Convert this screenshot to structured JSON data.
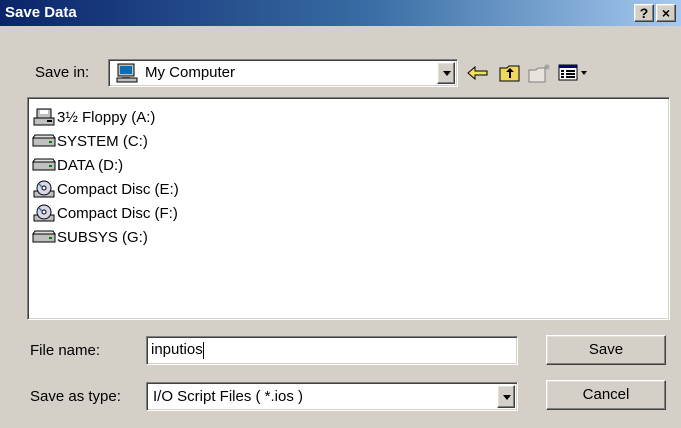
{
  "window": {
    "title": "Save Data",
    "help_label": "?",
    "close_label": "×"
  },
  "toolbar": {
    "save_in_label": "Save in:",
    "save_in_value": "My Computer",
    "icons": [
      "back-arrow-icon",
      "up-folder-icon",
      "new-folder-icon",
      "view-menu-icon"
    ]
  },
  "files": [
    {
      "label": "3½ Floppy (A:)",
      "icon": "floppy-drive-icon"
    },
    {
      "label": "SYSTEM (C:)",
      "icon": "hard-drive-icon"
    },
    {
      "label": "DATA (D:)",
      "icon": "hard-drive-icon"
    },
    {
      "label": "Compact Disc (E:)",
      "icon": "cd-drive-icon"
    },
    {
      "label": "Compact Disc (F:)",
      "icon": "cd-drive-icon"
    },
    {
      "label": "SUBSYS (G:)",
      "icon": "hard-drive-icon"
    }
  ],
  "form": {
    "file_name_label": "File name:",
    "file_name_value": "inputios",
    "save_as_type_label": "Save as type:",
    "save_as_type_value": "I/O Script Files ( *.ios )"
  },
  "buttons": {
    "save": "Save",
    "cancel": "Cancel"
  }
}
